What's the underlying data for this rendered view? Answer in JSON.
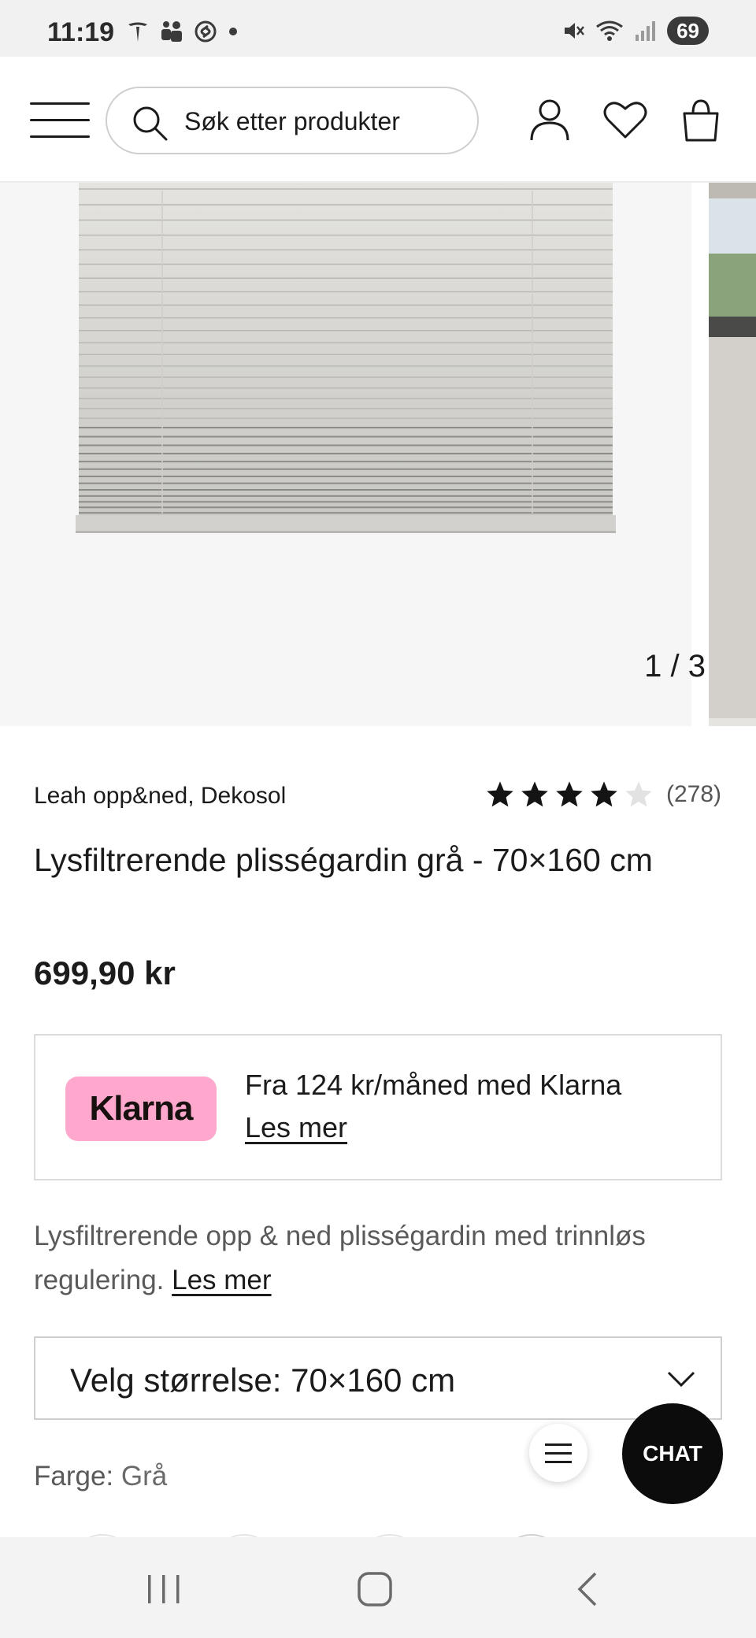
{
  "status_bar": {
    "time": "11:19",
    "left_icons": [
      "tesla-icon",
      "teams-icon",
      "shazam-icon",
      "dot-icon"
    ],
    "right_icons": [
      "mute-icon",
      "wifi-icon",
      "signal-icon"
    ],
    "battery": "69"
  },
  "header": {
    "search_placeholder": "Søk etter produkter",
    "icons": [
      "menu-icon",
      "search-icon",
      "account-icon",
      "wishlist-heart-icon",
      "cart-bag-icon"
    ]
  },
  "gallery": {
    "counter": "1 / 3"
  },
  "product": {
    "brand": "Leah opp&ned, Dekosol",
    "rating": 4,
    "rating_max": 5,
    "rating_count": "(278)",
    "title": "Lysfiltrerende plisségardin grå - 70×160 cm",
    "price": "699,90 kr"
  },
  "klarna": {
    "logo": "Klarna",
    "text": "Fra 124 kr/måned med Klarna",
    "link": "Les mer",
    "brand_color": "#ffa8cd"
  },
  "description": {
    "text": "Lysfiltrerende opp & ned plisségardin med trinnløs regulering.",
    "link": "Les mer"
  },
  "size_select": {
    "label": "Velg størrelse: 70×160 cm"
  },
  "color": {
    "label": "Farge:",
    "value": "Grå"
  },
  "chat": {
    "label": "CHAT"
  },
  "navbar": {
    "icons": [
      "recent-apps-icon",
      "home-icon",
      "back-icon"
    ]
  }
}
